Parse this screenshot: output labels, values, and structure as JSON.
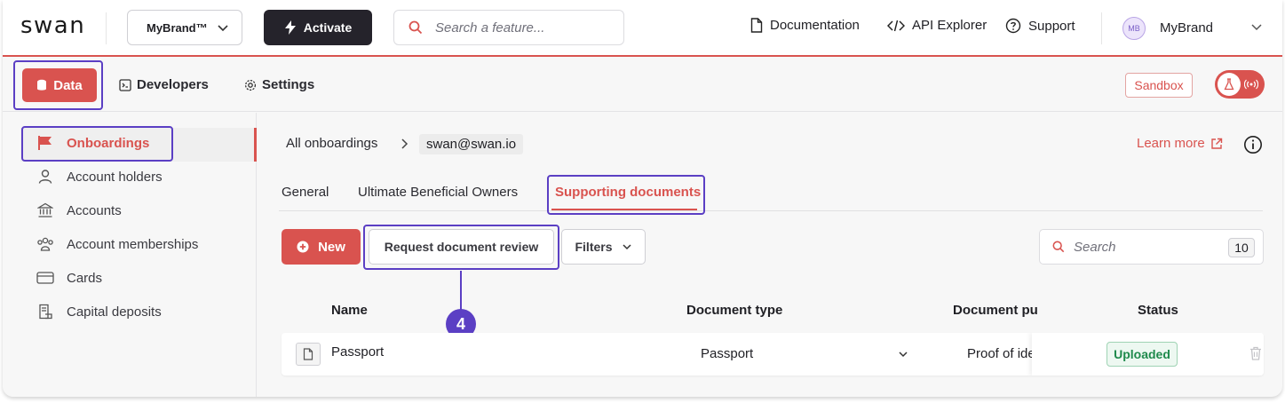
{
  "topbar": {
    "logo": "swan",
    "brand_select": "MyBrand™",
    "activate_label": "Activate",
    "search_placeholder": "Search a feature...",
    "documentation": "Documentation",
    "api_explorer": "API Explorer",
    "support": "Support",
    "avatar_initials": "MB",
    "user_name": "MyBrand"
  },
  "subnav": {
    "data": "Data",
    "developers": "Developers",
    "settings": "Settings",
    "sandbox": "Sandbox"
  },
  "sidebar": {
    "items": [
      {
        "label": "Onboardings",
        "icon": "flag-icon",
        "active": true
      },
      {
        "label": "Account holders",
        "icon": "person-icon"
      },
      {
        "label": "Accounts",
        "icon": "bank-icon"
      },
      {
        "label": "Account memberships",
        "icon": "users-icon"
      },
      {
        "label": "Cards",
        "icon": "card-icon"
      },
      {
        "label": "Capital deposits",
        "icon": "receipt-icon"
      }
    ]
  },
  "main": {
    "breadcrumb_root": "All onboardings",
    "breadcrumb_current": "swan@swan.io",
    "learn_more": "Learn more",
    "tabs": [
      "General",
      "Ultimate Beneficial Owners",
      "Supporting documents"
    ],
    "new_label": "New",
    "request_review_label": "Request document review",
    "filters_label": "Filters",
    "search_placeholder": "Search",
    "count": "10",
    "callout_number": "4",
    "columns": [
      "Name",
      "Document type",
      "Document pu",
      "Status"
    ],
    "rows": [
      {
        "name": "Passport",
        "type": "Passport",
        "purpose": "Proof of ide",
        "status": "Uploaded"
      }
    ]
  },
  "colors": {
    "accent": "#d9534f",
    "highlight": "#5b3fc4",
    "success": "#1f8a4c"
  }
}
